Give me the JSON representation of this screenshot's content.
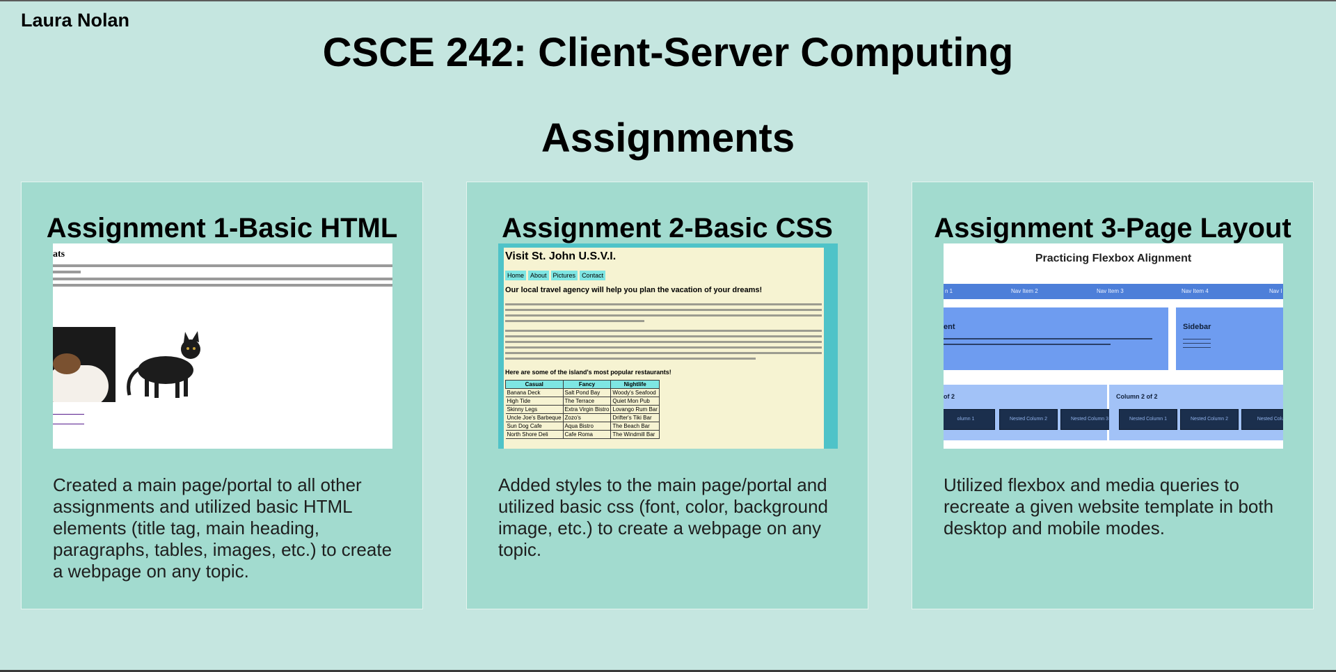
{
  "header": {
    "author": "Laura Nolan",
    "course_title": "CSCE 242: Client-Server Computing",
    "section_title": "Assignments"
  },
  "assignments": [
    {
      "title": "Assignment 1-Basic HTML",
      "description": "Created a main page/portal to all other assignments and utilized basic HTML elements (title tag, main heading, paragraphs, tables, images, etc.) to create a webpage on any topic.",
      "preview": {
        "heading": "ats"
      }
    },
    {
      "title": "Assignment 2-Basic CSS",
      "description": "Added styles to the main page/portal and utilized basic css (font, color, background image, etc.) to create a webpage on any topic.",
      "preview": {
        "heading": "Visit St. John U.S.V.I.",
        "nav": [
          "Home",
          "About",
          "Pictures",
          "Contact"
        ],
        "lead": "Our local travel agency will help you plan the vacation of your dreams!",
        "subheading": "Here are some of the island's most popular restaurants!",
        "table_headers": [
          "Casual",
          "Fancy",
          "Nightlife"
        ],
        "table_rows": [
          [
            "Banana Deck",
            "Salt Pond Bay",
            "Woody's Seafood"
          ],
          [
            "High Tide",
            "The Terrace",
            "Quiet Mon Pub"
          ],
          [
            "Skinny Legs",
            "Extra Virgin Bistro",
            "Lovango Rum Bar"
          ],
          [
            "Uncle Joe's Barbeque",
            "Zozo's",
            "Drifter's Tiki Bar"
          ],
          [
            "Sun Dog Cafe",
            "Aqua Bistro",
            "The Beach Bar"
          ],
          [
            "North Shore Deli",
            "Cafe Roma",
            "The Windmill Bar"
          ]
        ]
      }
    },
    {
      "title": "Assignment 3-Page Layout",
      "description": "Utilized flexbox and media queries to recreate a given website template in both desktop and mobile modes.",
      "preview": {
        "title": "Practicing Flexbox Alignment",
        "nav": [
          "n 1",
          "Nav Item 2",
          "Nav Item 3",
          "Nav Item 4",
          "Nav I"
        ],
        "content_heading": "ent",
        "sidebar_heading": "Sidebar",
        "col1_heading": "of 2",
        "col2_heading": "Column 2 of 2",
        "nested_a": [
          "olumn 1",
          "Nested Column 2",
          "Nested Column 3"
        ],
        "nested_b": [
          "Nested Column 1",
          "Nested Column 2",
          "Nested Colu"
        ]
      }
    }
  ]
}
